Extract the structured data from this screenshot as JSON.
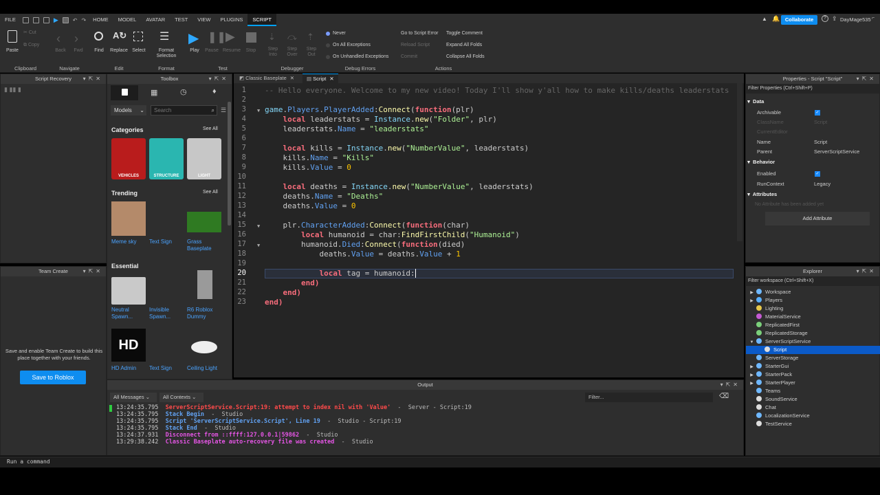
{
  "menu": {
    "items": [
      "FILE",
      "HOME",
      "MODEL",
      "AVATAR",
      "TEST",
      "VIEW",
      "PLUGINS",
      "SCRIPT"
    ],
    "active": "SCRIPT"
  },
  "topright": {
    "collaborate": "Collaborate",
    "username": "DayMage535"
  },
  "ribbon": {
    "clipboard": {
      "paste": "Paste",
      "cut": "Cut",
      "copy": "Copy",
      "group": "Clipboard"
    },
    "navigate": {
      "back": "Back",
      "fwd": "Fwd",
      "group": "Navigate"
    },
    "edit": {
      "find": "Find",
      "replace": "Replace",
      "select": "Select",
      "group": "Edit"
    },
    "format": {
      "format_selection": "Format Selection",
      "group": "Format"
    },
    "test": {
      "play": "Play",
      "pause": "Pause",
      "resume": "Resume",
      "stop": "Stop",
      "group": "Test"
    },
    "debugger": {
      "step_into": "Step Into",
      "step_over": "Step Over",
      "step_out": "Step Out",
      "group": "Debugger"
    },
    "debug_errors": {
      "never": "Never",
      "on_all": "On All Exceptions",
      "on_unhandled": "On Unhandled Exceptions",
      "group": "Debug Errors"
    },
    "actions": {
      "go_to_error": "Go to Script Error",
      "reload": "Reload Script",
      "commit": "Commit",
      "toggle_comment": "Toggle Comment",
      "expand_all": "Expand All Folds",
      "collapse_all": "Collapse All Folds",
      "group": "Actions"
    }
  },
  "script_recovery": {
    "title": "Script Recovery"
  },
  "toolbox": {
    "title": "Toolbox",
    "dropdown": "Models",
    "search_placeholder": "Search",
    "categories_title": "Categories",
    "see_all": "See All",
    "categories": [
      "VEHICLES",
      "STRUCTURE",
      "LIGHT"
    ],
    "trending_title": "Trending",
    "trending": [
      "Meme sky",
      "Text Sign",
      "Grass Baseplate"
    ],
    "essential_title": "Essential",
    "essential": [
      "Neutral Spawn...",
      "Invisible Spawn...",
      "R6 Roblox Dummy"
    ],
    "row4": [
      "HD Admin",
      "Text Sign",
      "Ceiling Light"
    ],
    "hd_text": "HD"
  },
  "team_create": {
    "title": "Team Create",
    "message": "Save and enable Team Create to build this place together with your friends.",
    "button": "Save to Roblox"
  },
  "tabs": [
    {
      "label": "Classic Baseplate"
    },
    {
      "label": "Script"
    }
  ],
  "code": {
    "lines": [
      "1",
      "2",
      "3",
      "4",
      "5",
      "6",
      "7",
      "8",
      "9",
      "10",
      "11",
      "12",
      "13",
      "14",
      "15",
      "16",
      "17",
      "18",
      "19",
      "20",
      "21",
      "22",
      "23"
    ],
    "comment": "-- Hello everyone. Welcome to my new video! Today I'll show y'all how to make kills/deaths leaderstats",
    "t": {
      "game": "game",
      "Players": "Players",
      "PlayerAdded": "PlayerAdded",
      "Connect": "Connect",
      "function": "function",
      "plr": "(plr)",
      "local": "local",
      "leaderstats": "leaderstats",
      "Instance": "Instance",
      "new": "new",
      "Folder": "\"Folder\"",
      "plr_arg": ", plr)",
      "Name": "Name",
      "leaderstats_s": "\"leaderstats\"",
      "kills": "kills",
      "NumberValue": "\"NumberValue\"",
      "ls_arg": ", leaderstats)",
      "Kills_s": "\"Kills\"",
      "Value": "Value",
      "zero": "0",
      "deaths": "deaths",
      "Deaths_s": "\"Deaths\"",
      "CharacterAdded": "CharacterAdded",
      "char": "(char)",
      "humanoid": "humanoid",
      "FindFirstChild": "FindFirstChild",
      "Humanoid_s": "\"Humanoid\"",
      "Died": "Died",
      "died": "(died)",
      "one": "1",
      "tag": "tag",
      "end": "end",
      "endp": "end)"
    }
  },
  "properties": {
    "title": "Properties - Script \"Script\"",
    "filter": "Filter Properties (Ctrl+Shift+P)",
    "sections": {
      "data": "Data",
      "behavior": "Behavior",
      "attributes": "Attributes"
    },
    "rows": {
      "archivable": "Archivable",
      "classname": "ClassName",
      "classname_val": "Script",
      "current_editor": "CurrentEditor",
      "name": "Name",
      "name_val": "Script",
      "parent": "Parent",
      "parent_val": "ServerScriptService",
      "enabled": "Enabled",
      "runcontext": "RunContext",
      "runcontext_val": "Legacy"
    },
    "no_attr": "No Attribute has been added yet",
    "add_attr": "Add Attribute"
  },
  "explorer": {
    "title": "Explorer",
    "filter": "Filter workspace (Ctrl+Shift+X)",
    "items": [
      "Workspace",
      "Players",
      "Lighting",
      "MaterialService",
      "ReplicatedFirst",
      "ReplicatedStorage",
      "ServerScriptService",
      "Script",
      "ServerStorage",
      "StarterGui",
      "StarterPack",
      "StarterPlayer",
      "Teams",
      "SoundService",
      "Chat",
      "LocalizationService",
      "TestService"
    ],
    "selected": "Script"
  },
  "output": {
    "title": "Output",
    "all_messages": "All Messages",
    "all_contexts": "All Contexts",
    "filter_placeholder": "Filter...",
    "lines": [
      {
        "time": "13:24:35.795",
        "msg": "ServerScriptService.Script:19: attempt to index nil with 'Value'",
        "src": "  -  Server - Script:19",
        "color": "#ff4a4a"
      },
      {
        "time": "13:24:35.795",
        "msg": "Stack Begin",
        "src": "  -  Studio",
        "color": "#61a1f1"
      },
      {
        "time": "13:24:35.795",
        "msg": "Script 'ServerScriptService.Script', Line 19",
        "src": "  -  Studio - Script:19",
        "color": "#61a1f1"
      },
      {
        "time": "13:24:35.795",
        "msg": "Stack End",
        "src": "  -  Studio",
        "color": "#61a1f1"
      },
      {
        "time": "13:24:37.931",
        "msg": "Disconnect from ::ffff:127.0.0.1|59862",
        "src": "  -  Studio",
        "color": "#e455e4"
      },
      {
        "time": "13:29:38.242",
        "msg": "Classic Baseplate auto-recovery file was created",
        "src": "  -  Studio",
        "color": "#e455e4"
      }
    ]
  },
  "command_bar": {
    "placeholder": "Run a command"
  }
}
